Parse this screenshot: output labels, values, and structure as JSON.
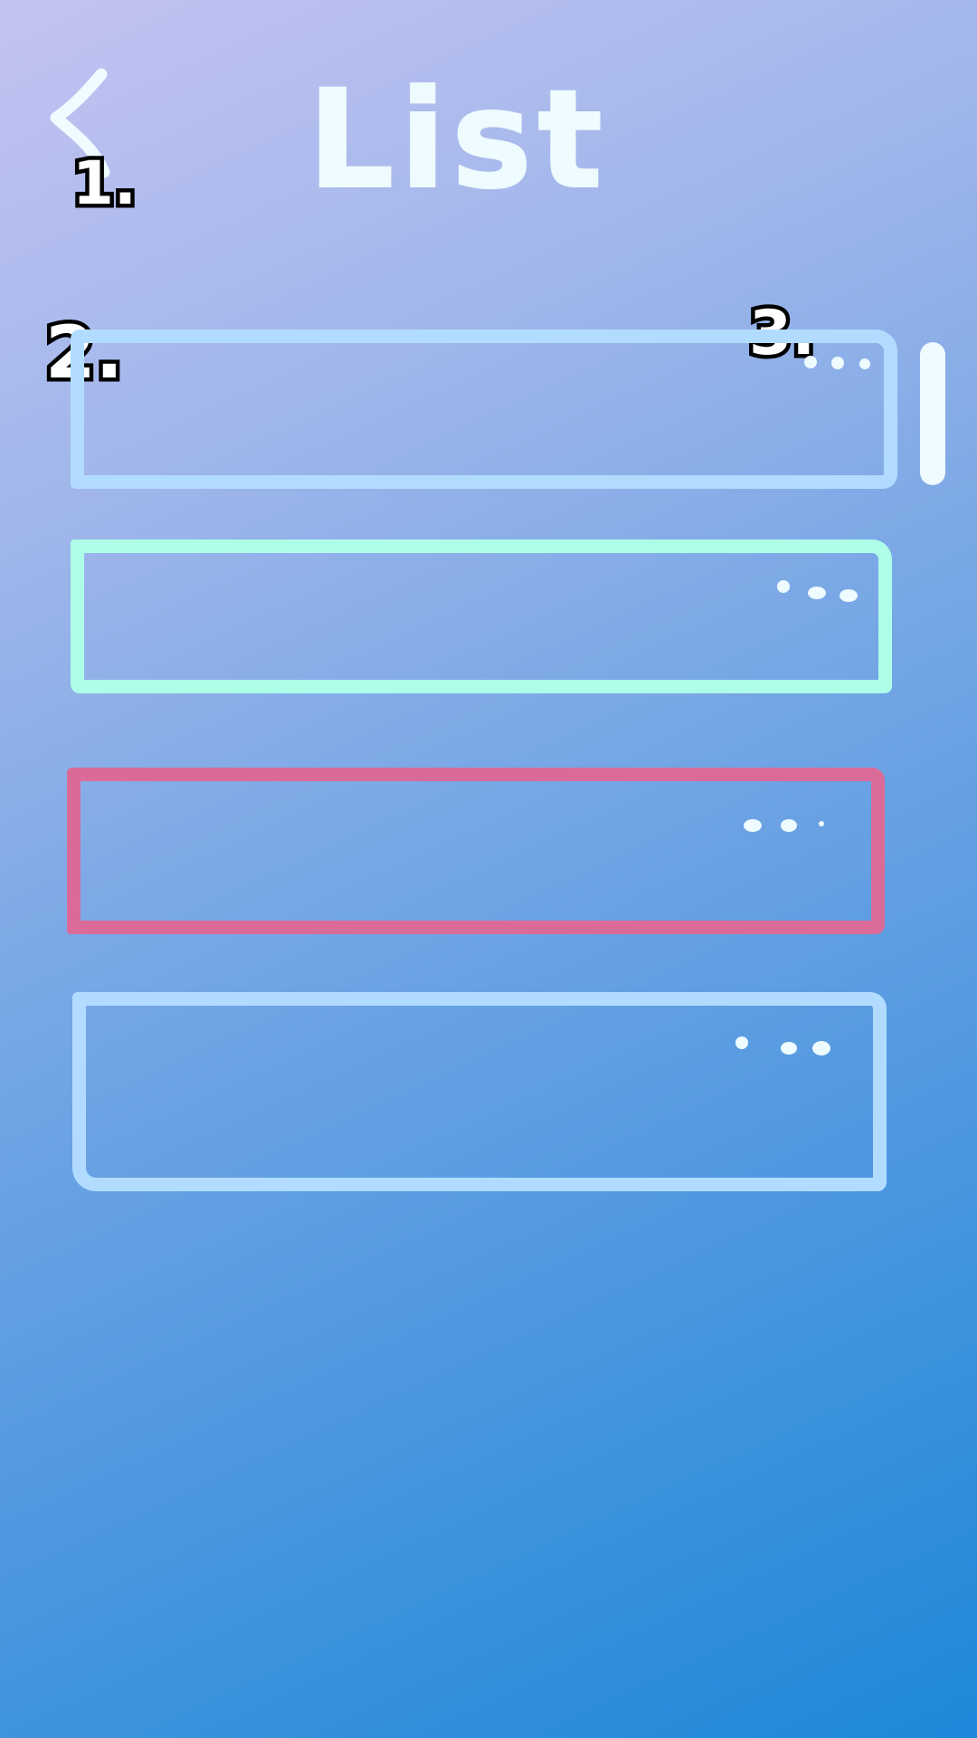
{
  "header": {
    "title": "List",
    "back_icon": "chevron-left-icon"
  },
  "annotations": {
    "back": "1.",
    "list_item": "2.",
    "more_options": "3."
  },
  "list": {
    "items": [
      {
        "border_color": "#b2dcff",
        "more_icon": "more-horizontal-icon"
      },
      {
        "border_color": "#aefde9",
        "more_icon": "more-horizontal-icon"
      },
      {
        "border_color": "#da6b99",
        "more_icon": "more-horizontal-icon"
      },
      {
        "border_color": "#b2dcff",
        "more_icon": "more-horizontal-icon"
      }
    ]
  },
  "colors": {
    "background_top": "#c3c3f1",
    "background_bottom": "#1d88da",
    "foreground": "#eefbff"
  }
}
